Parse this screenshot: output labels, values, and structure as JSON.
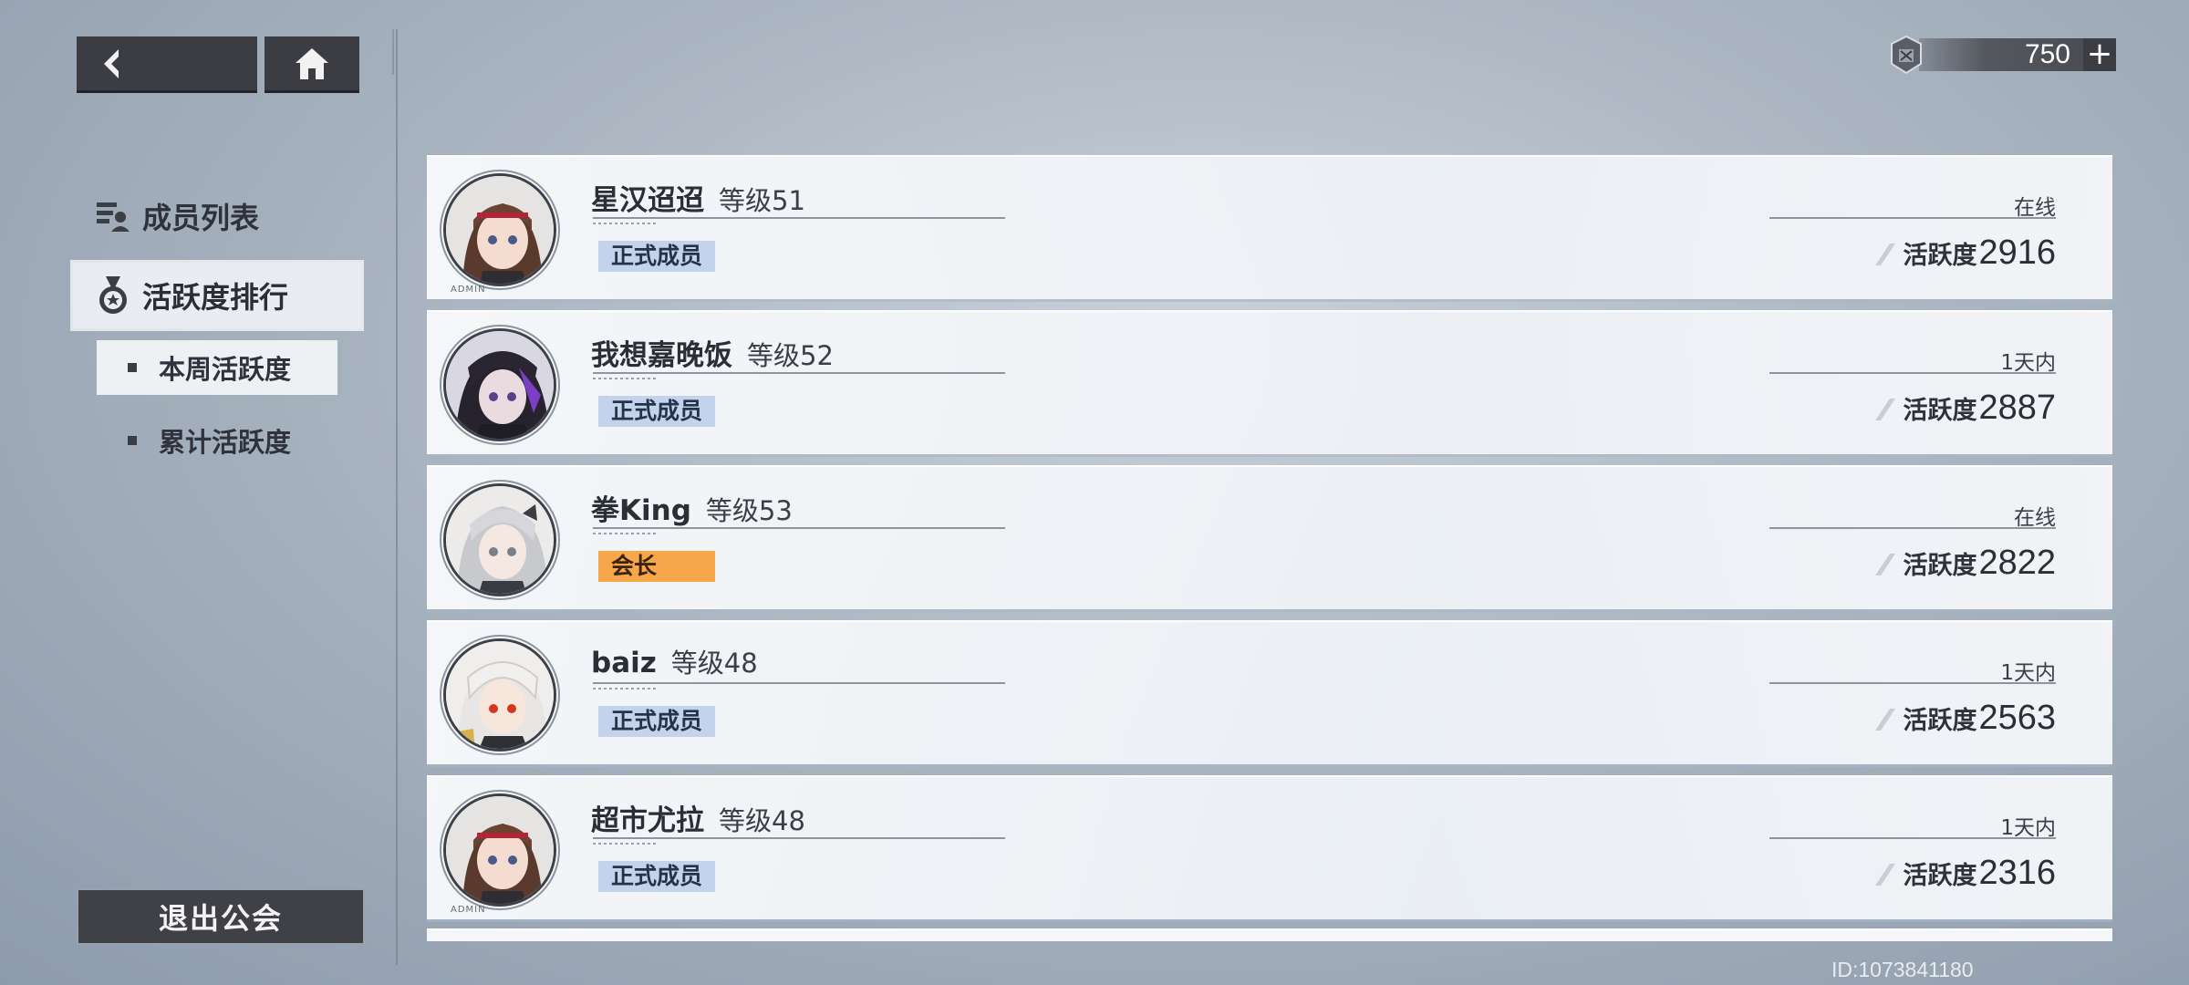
{
  "top_bar": {
    "currency_value": "750",
    "currency_plus": "+"
  },
  "sidebar": {
    "title": "成员列表",
    "active_section": "活跃度排行",
    "sub_items": [
      {
        "label": "本周活跃度",
        "selected": true
      },
      {
        "label": "累计活跃度",
        "selected": false
      }
    ],
    "quit_label": "退出公会"
  },
  "members": [
    {
      "name": "星汉迢迢",
      "level": "等级51",
      "role": "正式成员",
      "role_type": "member",
      "status": "在线",
      "activity_label": "活跃度",
      "activity_value": "2916",
      "admin_tag": "ADMIN",
      "avatar": "brown-hair-red-headband"
    },
    {
      "name": "我想嘉晚饭",
      "level": "等级52",
      "role": "正式成员",
      "role_type": "member",
      "status": "1天内",
      "activity_label": "活跃度",
      "activity_value": "2887",
      "admin_tag": "",
      "avatar": "dark-hair-purple"
    },
    {
      "name": "拳King",
      "level": "等级53",
      "role": "会长",
      "role_type": "leader",
      "status": "在线",
      "activity_label": "活跃度",
      "activity_value": "2822",
      "admin_tag": "",
      "avatar": "silver-hair"
    },
    {
      "name": "baiz",
      "level": "等级48",
      "role": "正式成员",
      "role_type": "member",
      "status": "1天内",
      "activity_label": "活跃度",
      "activity_value": "2563",
      "admin_tag": "",
      "avatar": "white-hair-red-eyes"
    },
    {
      "name": "超市尤拉",
      "level": "等级48",
      "role": "正式成员",
      "role_type": "member",
      "status": "1天内",
      "activity_label": "活跃度",
      "activity_value": "2316",
      "admin_tag": "ADMIN",
      "avatar": "brown-hair-red-headband"
    }
  ],
  "footer": {
    "uid": "ID:1073841180"
  },
  "colors": {
    "member_badge": "#c3d3ec",
    "leader_badge": "#f7a64a",
    "activity_accent": "#7a2a2a"
  }
}
